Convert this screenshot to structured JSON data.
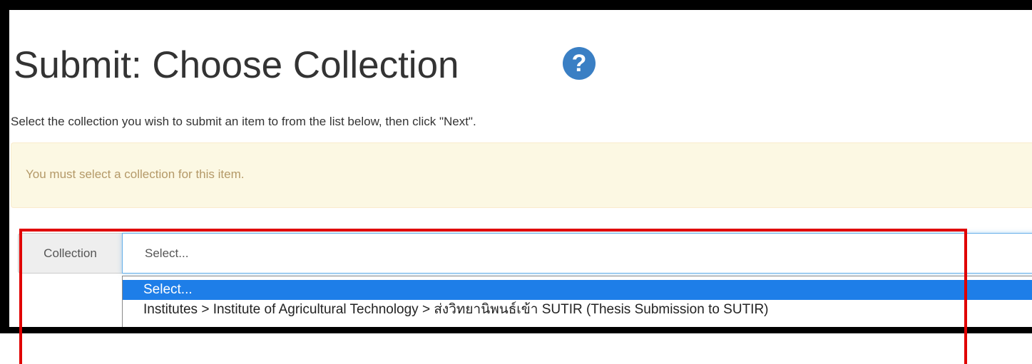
{
  "page": {
    "title": "Submit: Choose Collection",
    "help_icon": "question-circle-icon",
    "intro": "Select the collection you wish to submit an item to from the list below, then click \"Next\"."
  },
  "alert": {
    "message": "You must select a collection for this item."
  },
  "collection": {
    "label": "Collection",
    "selected": "Select...",
    "options": [
      "Select...",
      "Institutes > Institute of Agricultural Technology > ส่งวิทยานิพนธ์เข้า SUTIR (Thesis Submission to SUTIR)"
    ]
  },
  "colors": {
    "help_icon": "#3a7fc4",
    "alert_bg": "#fcf8e3",
    "alert_text": "#b49968",
    "highlight": "#1e7ee8",
    "annotation": "#e00000"
  }
}
